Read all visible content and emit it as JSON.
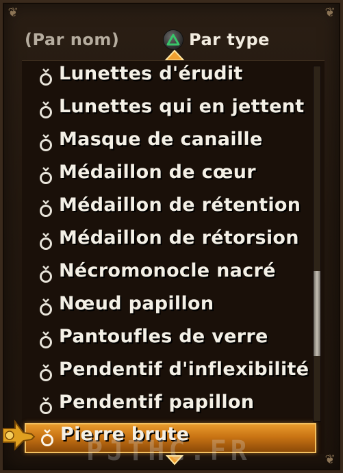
{
  "sort": {
    "by_name_label": "(Par nom)",
    "by_type_label": "Par type",
    "button_icon": "triangle-button-icon"
  },
  "list": {
    "items": [
      {
        "label": "Lunettes d'érudit",
        "icon": "ring-icon"
      },
      {
        "label": "Lunettes qui en jettent",
        "icon": "ring-icon"
      },
      {
        "label": "Masque de canaille",
        "icon": "ring-icon"
      },
      {
        "label": "Médaillon de cœur",
        "icon": "ring-icon"
      },
      {
        "label": "Médaillon de rétention",
        "icon": "ring-icon"
      },
      {
        "label": "Médaillon de rétorsion",
        "icon": "ring-icon"
      },
      {
        "label": "Nécromonocle nacré",
        "icon": "ring-icon"
      },
      {
        "label": "Nœud papillon",
        "icon": "ring-icon"
      },
      {
        "label": "Pantoufles de verre",
        "icon": "ring-icon"
      },
      {
        "label": "Pendentif d'inflexibilité",
        "icon": "ring-icon"
      },
      {
        "label": "Pendentif papillon",
        "icon": "ring-icon"
      },
      {
        "label": "Pierre brute",
        "icon": "ring-icon",
        "selected": true
      }
    ],
    "selected_index": 11,
    "scroll_position": 0.76
  },
  "watermark": "PJTHC.FR",
  "colors": {
    "selection": "#c97414",
    "selection_border": "#f3c060",
    "text": "#f4f0e6",
    "inactive_text": "#b6ad9f",
    "triangle": "#39c66a"
  }
}
